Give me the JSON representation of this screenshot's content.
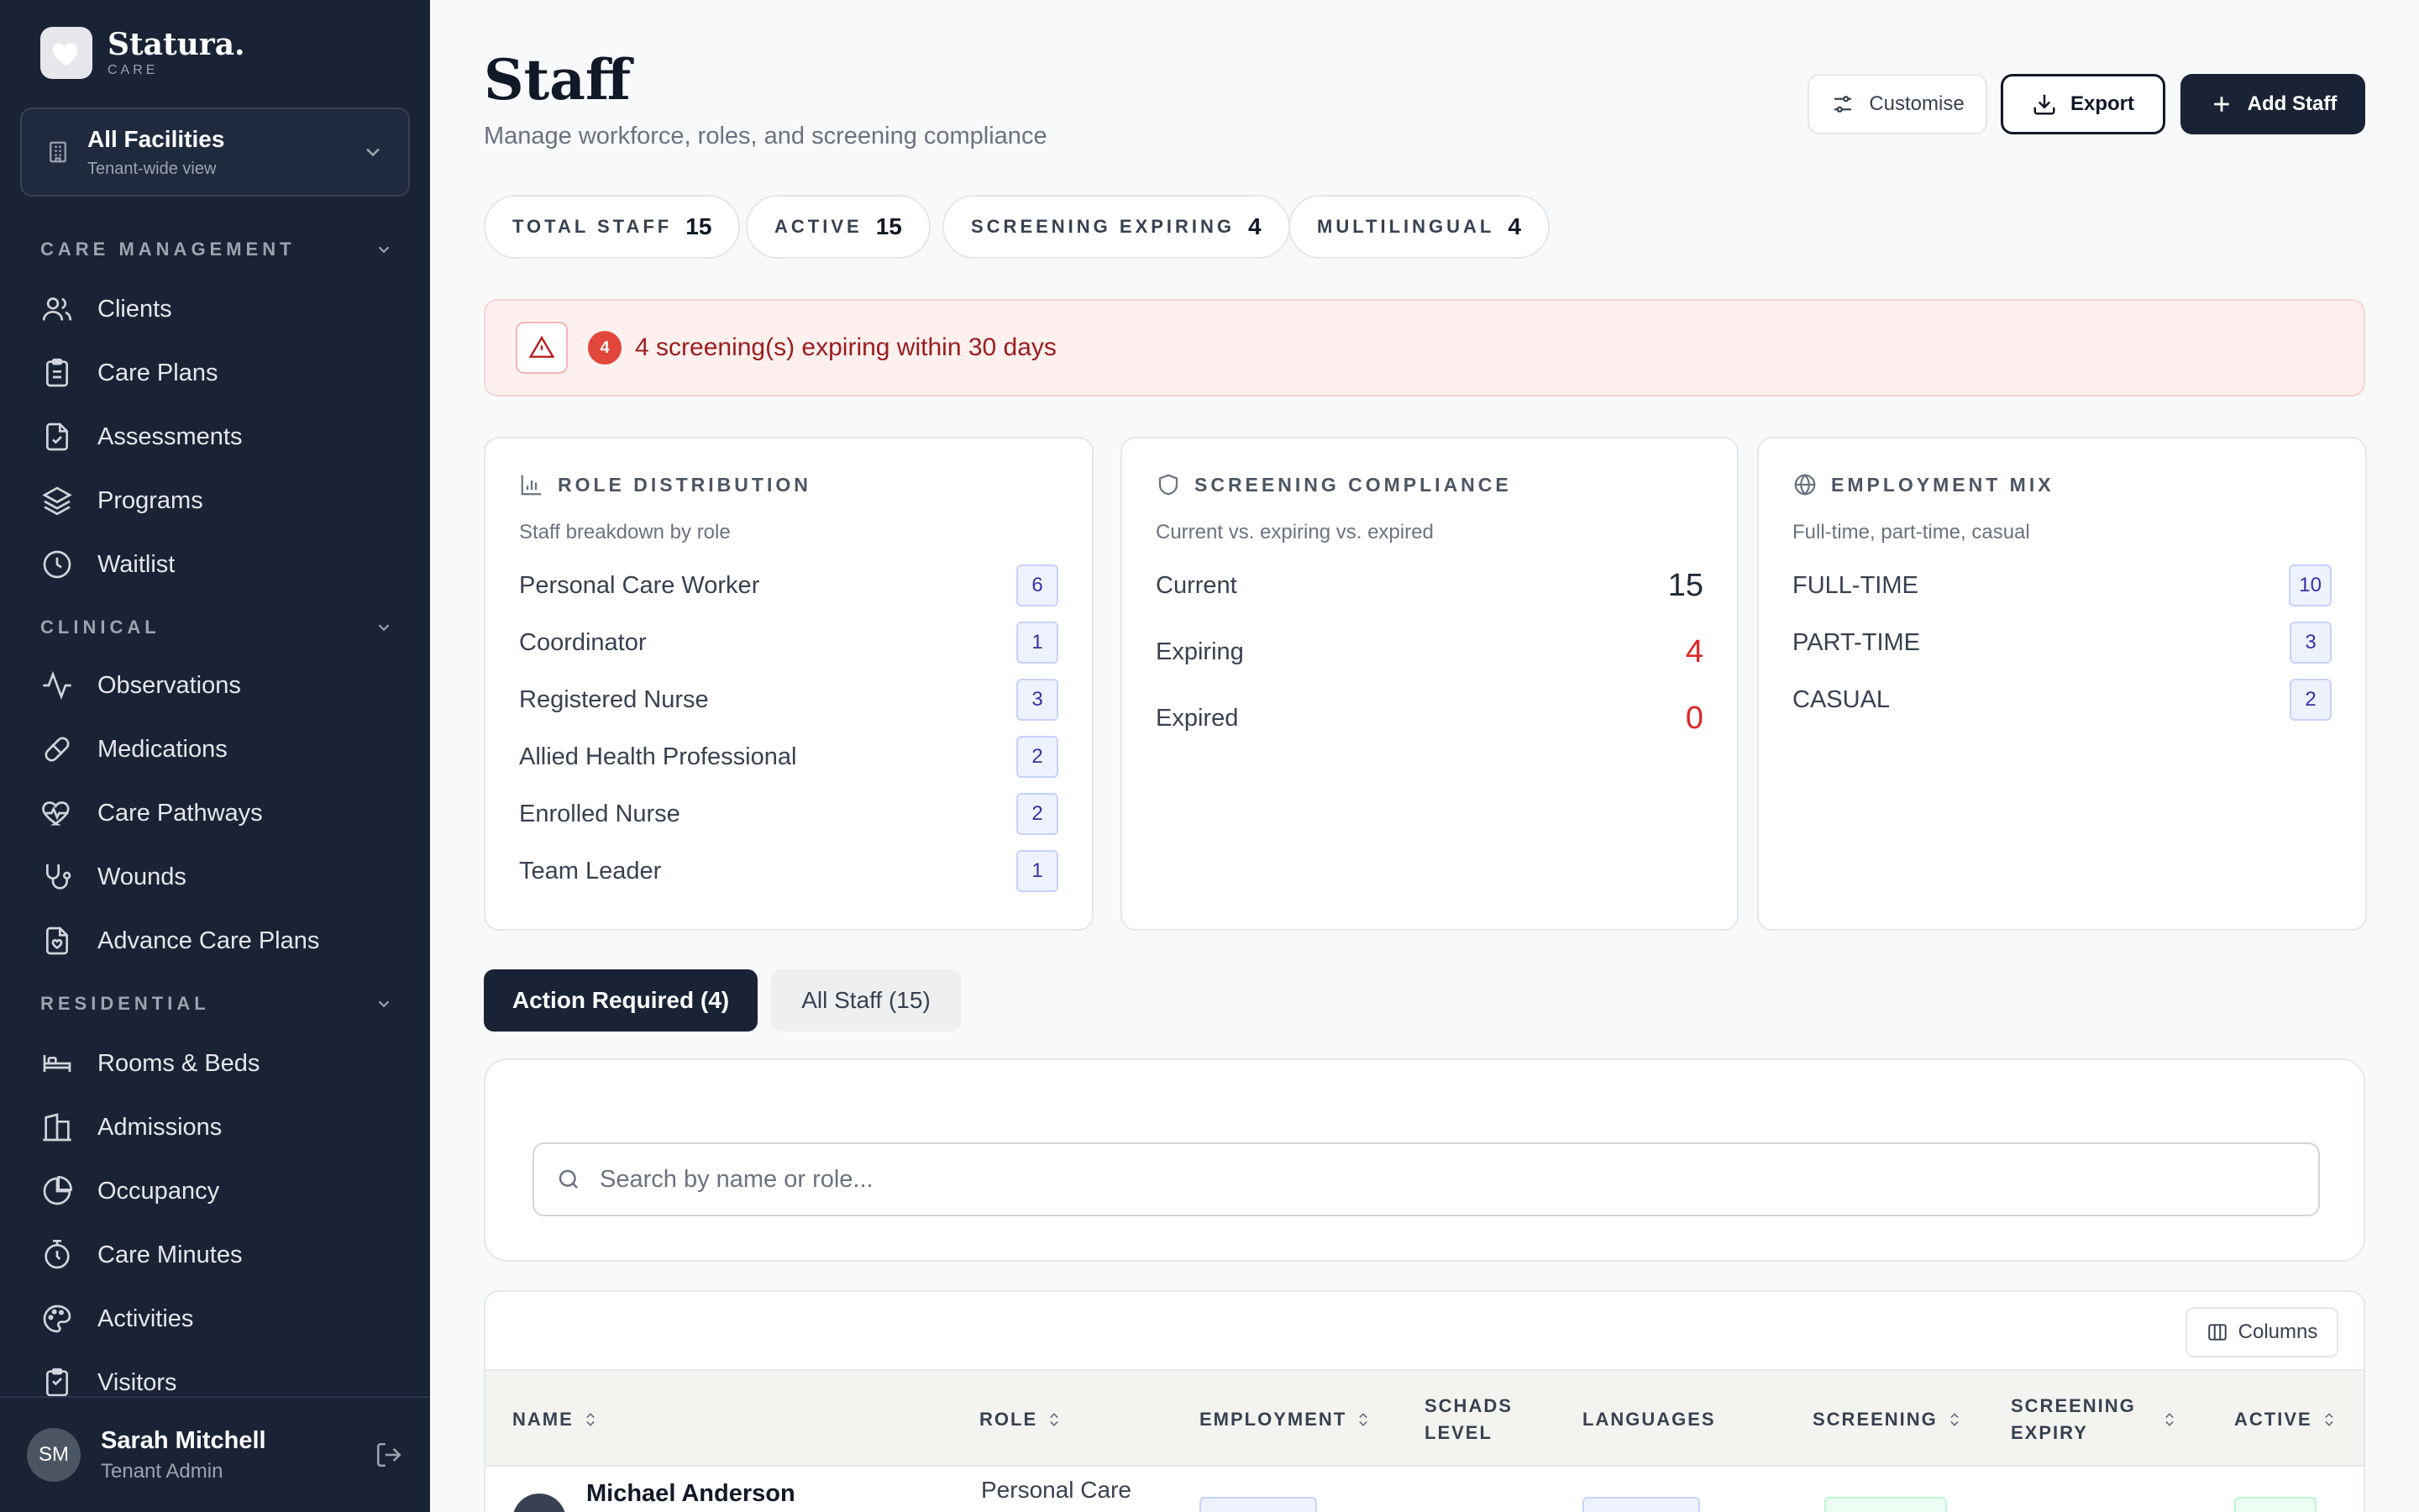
{
  "brand": {
    "name": "Statura.",
    "sub": "CARE"
  },
  "facility": {
    "title": "All Facilities",
    "subtitle": "Tenant-wide view"
  },
  "sidebar": {
    "sections": [
      {
        "label": "CARE MANAGEMENT",
        "items": [
          {
            "label": "Clients",
            "icon": "users-icon"
          },
          {
            "label": "Care Plans",
            "icon": "clipboard-icon"
          },
          {
            "label": "Assessments",
            "icon": "file-check-icon"
          },
          {
            "label": "Programs",
            "icon": "layers-icon"
          },
          {
            "label": "Waitlist",
            "icon": "clock-icon"
          }
        ]
      },
      {
        "label": "CLINICAL",
        "items": [
          {
            "label": "Observations",
            "icon": "activity-icon"
          },
          {
            "label": "Medications",
            "icon": "pill-icon"
          },
          {
            "label": "Care Pathways",
            "icon": "heart-pulse-icon"
          },
          {
            "label": "Wounds",
            "icon": "stethoscope-icon"
          },
          {
            "label": "Advance Care Plans",
            "icon": "file-heart-icon"
          }
        ]
      },
      {
        "label": "RESIDENTIAL",
        "items": [
          {
            "label": "Rooms & Beds",
            "icon": "bed-icon"
          },
          {
            "label": "Admissions",
            "icon": "building-icon"
          },
          {
            "label": "Occupancy",
            "icon": "pie-chart-icon"
          },
          {
            "label": "Care Minutes",
            "icon": "timer-icon"
          },
          {
            "label": "Activities",
            "icon": "palette-icon"
          },
          {
            "label": "Visitors",
            "icon": "clipboard-user-icon"
          }
        ]
      }
    ]
  },
  "user": {
    "initials": "SM",
    "name": "Sarah Mitchell",
    "role": "Tenant Admin"
  },
  "header": {
    "title": "Staff",
    "subtitle": "Manage workforce, roles, and screening compliance",
    "customise_label": "Customise",
    "export_label": "Export",
    "add_label": "Add Staff"
  },
  "stats": [
    {
      "label": "TOTAL STAFF",
      "value": "15"
    },
    {
      "label": "ACTIVE",
      "value": "15"
    },
    {
      "label": "SCREENING EXPIRING",
      "value": "4"
    },
    {
      "label": "MULTILINGUAL",
      "value": "4"
    }
  ],
  "alert": {
    "count": "4",
    "text": "4 screening(s) expiring within 30 days"
  },
  "role_distribution": {
    "title": "ROLE DISTRIBUTION",
    "subtitle": "Staff breakdown by role",
    "rows": [
      {
        "label": "Personal Care Worker",
        "value": "6"
      },
      {
        "label": "Coordinator",
        "value": "1"
      },
      {
        "label": "Registered Nurse",
        "value": "3"
      },
      {
        "label": "Allied Health Professional",
        "value": "2"
      },
      {
        "label": "Enrolled Nurse",
        "value": "2"
      },
      {
        "label": "Team Leader",
        "value": "1"
      }
    ]
  },
  "screening": {
    "title": "SCREENING COMPLIANCE",
    "subtitle": "Current vs. expiring vs. expired",
    "rows": [
      {
        "label": "Current",
        "value": "15"
      },
      {
        "label": "Expiring",
        "value": "4"
      },
      {
        "label": "Expired",
        "value": "0"
      }
    ]
  },
  "employment": {
    "title": "EMPLOYMENT MIX",
    "subtitle": "Full-time, part-time, casual",
    "rows": [
      {
        "label": "FULL-TIME",
        "value": "10"
      },
      {
        "label": "PART-TIME",
        "value": "3"
      },
      {
        "label": "CASUAL",
        "value": "2"
      }
    ]
  },
  "tabs": {
    "action": "Action Required (4)",
    "all": "All Staff (15)"
  },
  "search": {
    "placeholder": "Search by name or role..."
  },
  "table": {
    "columns_label": "Columns",
    "headers": {
      "name": "NAME",
      "role": "ROLE",
      "employment": "EMPLOYMENT",
      "schads_1": "SCHADS",
      "schads_2": "LEVEL",
      "languages": "LANGUAGES",
      "screening": "SCREENING",
      "expiry_1": "SCREENING",
      "expiry_2": "EXPIRY",
      "active": "ACTIVE"
    },
    "rows": [
      {
        "name": "Michael Anderson",
        "role": "Personal Care"
      }
    ]
  },
  "colors": {
    "sidebar": "#1a2336",
    "accent_red": "#dc2626",
    "badge_bg": "#eef2ff"
  }
}
